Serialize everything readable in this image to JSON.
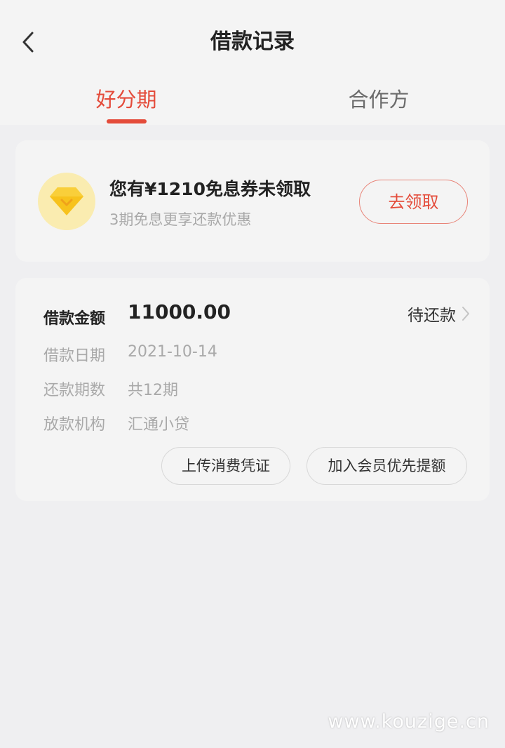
{
  "header": {
    "title": "借款记录",
    "tabs": [
      {
        "label": "好分期",
        "active": true
      },
      {
        "label": "合作方",
        "active": false
      }
    ]
  },
  "coupon": {
    "title": "您有¥1210免息券未领取",
    "subtitle": "3期免息更享还款优惠",
    "button_label": "去领取",
    "icon": "diamond-icon"
  },
  "loan": {
    "amount_label": "借款金额",
    "amount_value": "11000.00",
    "status": "待还款",
    "rows": [
      {
        "label": "借款日期",
        "value": "2021-10-14"
      },
      {
        "label": "还款期数",
        "value": "共12期"
      },
      {
        "label": "放款机构",
        "value": "汇通小贷"
      }
    ],
    "actions": [
      {
        "label": "上传消费凭证"
      },
      {
        "label": "加入会员优先提额"
      }
    ]
  },
  "watermark": "www.kouzige.cn",
  "colors": {
    "accent": "#e44b3a",
    "background": "#efeff1",
    "card": "#f4f4f4",
    "badge": "#faecb0",
    "diamond": "#f7c21c"
  }
}
